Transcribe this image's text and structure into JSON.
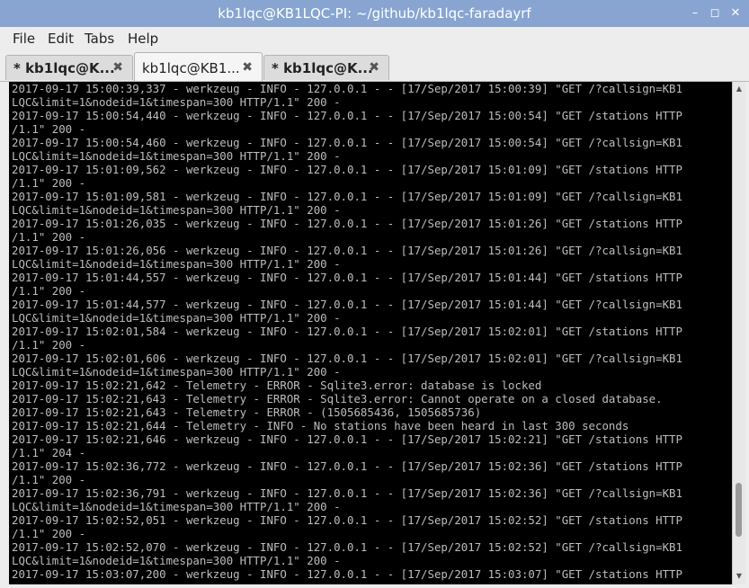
{
  "window": {
    "title": "kb1lqc@KB1LQC-PI: ~/github/kb1lqc-faradayrf",
    "controls": {
      "minimize": "–",
      "maximize": "◻",
      "close": "✕"
    }
  },
  "menubar": {
    "items": [
      "File",
      "Edit",
      "Tabs",
      "Help"
    ]
  },
  "tabs": [
    {
      "label": "* kb1lqc@K...",
      "close": "✖"
    },
    {
      "label": "kb1lqc@KB1...",
      "close": "✖"
    },
    {
      "label": "* kb1lqc@K...",
      "close": "✖"
    }
  ],
  "scrollbar": {
    "up": "▲",
    "down": "▼"
  },
  "terminal": {
    "lines": [
      "2017-09-17 15:00:39,337 - werkzeug - INFO - 127.0.0.1 - - [17/Sep/2017 15:00:39] \"GET /?callsign=KB1",
      "LQC&limit=1&nodeid=1&timespan=300 HTTP/1.1\" 200 -",
      "2017-09-17 15:00:54,440 - werkzeug - INFO - 127.0.0.1 - - [17/Sep/2017 15:00:54] \"GET /stations HTTP",
      "/1.1\" 200 -",
      "2017-09-17 15:00:54,460 - werkzeug - INFO - 127.0.0.1 - - [17/Sep/2017 15:00:54] \"GET /?callsign=KB1",
      "LQC&limit=1&nodeid=1&timespan=300 HTTP/1.1\" 200 -",
      "2017-09-17 15:01:09,562 - werkzeug - INFO - 127.0.0.1 - - [17/Sep/2017 15:01:09] \"GET /stations HTTP",
      "/1.1\" 200 -",
      "2017-09-17 15:01:09,581 - werkzeug - INFO - 127.0.0.1 - - [17/Sep/2017 15:01:09] \"GET /?callsign=KB1",
      "LQC&limit=1&nodeid=1&timespan=300 HTTP/1.1\" 200 -",
      "2017-09-17 15:01:26,035 - werkzeug - INFO - 127.0.0.1 - - [17/Sep/2017 15:01:26] \"GET /stations HTTP",
      "/1.1\" 200 -",
      "2017-09-17 15:01:26,056 - werkzeug - INFO - 127.0.0.1 - - [17/Sep/2017 15:01:26] \"GET /?callsign=KB1",
      "LQC&limit=1&nodeid=1&timespan=300 HTTP/1.1\" 200 -",
      "2017-09-17 15:01:44,557 - werkzeug - INFO - 127.0.0.1 - - [17/Sep/2017 15:01:44] \"GET /stations HTTP",
      "/1.1\" 200 -",
      "2017-09-17 15:01:44,577 - werkzeug - INFO - 127.0.0.1 - - [17/Sep/2017 15:01:44] \"GET /?callsign=KB1",
      "LQC&limit=1&nodeid=1&timespan=300 HTTP/1.1\" 200 -",
      "2017-09-17 15:02:01,584 - werkzeug - INFO - 127.0.0.1 - - [17/Sep/2017 15:02:01] \"GET /stations HTTP",
      "/1.1\" 200 -",
      "2017-09-17 15:02:01,606 - werkzeug - INFO - 127.0.0.1 - - [17/Sep/2017 15:02:01] \"GET /?callsign=KB1",
      "LQC&limit=1&nodeid=1&timespan=300 HTTP/1.1\" 200 -",
      "2017-09-17 15:02:21,642 - Telemetry - ERROR - Sqlite3.error: database is locked",
      "2017-09-17 15:02:21,643 - Telemetry - ERROR - Sqlite3.error: Cannot operate on a closed database.",
      "2017-09-17 15:02:21,643 - Telemetry - ERROR - (1505685436, 1505685736)",
      "2017-09-17 15:02:21,644 - Telemetry - INFO - No stations have been heard in last 300 seconds",
      "2017-09-17 15:02:21,646 - werkzeug - INFO - 127.0.0.1 - - [17/Sep/2017 15:02:21] \"GET /stations HTTP",
      "/1.1\" 204 -",
      "2017-09-17 15:02:36,772 - werkzeug - INFO - 127.0.0.1 - - [17/Sep/2017 15:02:36] \"GET /stations HTTP",
      "/1.1\" 200 -",
      "2017-09-17 15:02:36,791 - werkzeug - INFO - 127.0.0.1 - - [17/Sep/2017 15:02:36] \"GET /?callsign=KB1",
      "LQC&limit=1&nodeid=1&timespan=300 HTTP/1.1\" 200 -",
      "2017-09-17 15:02:52,051 - werkzeug - INFO - 127.0.0.1 - - [17/Sep/2017 15:02:52] \"GET /stations HTTP",
      "/1.1\" 200 -",
      "2017-09-17 15:02:52,070 - werkzeug - INFO - 127.0.0.1 - - [17/Sep/2017 15:02:52] \"GET /?callsign=KB1",
      "LQC&limit=1&nodeid=1&timespan=300 HTTP/1.1\" 200 -",
      "2017-09-17 15:03:07,200 - werkzeug - INFO - 127.0.0.1 - - [17/Sep/2017 15:03:07] \"GET /stations HTTP"
    ]
  }
}
